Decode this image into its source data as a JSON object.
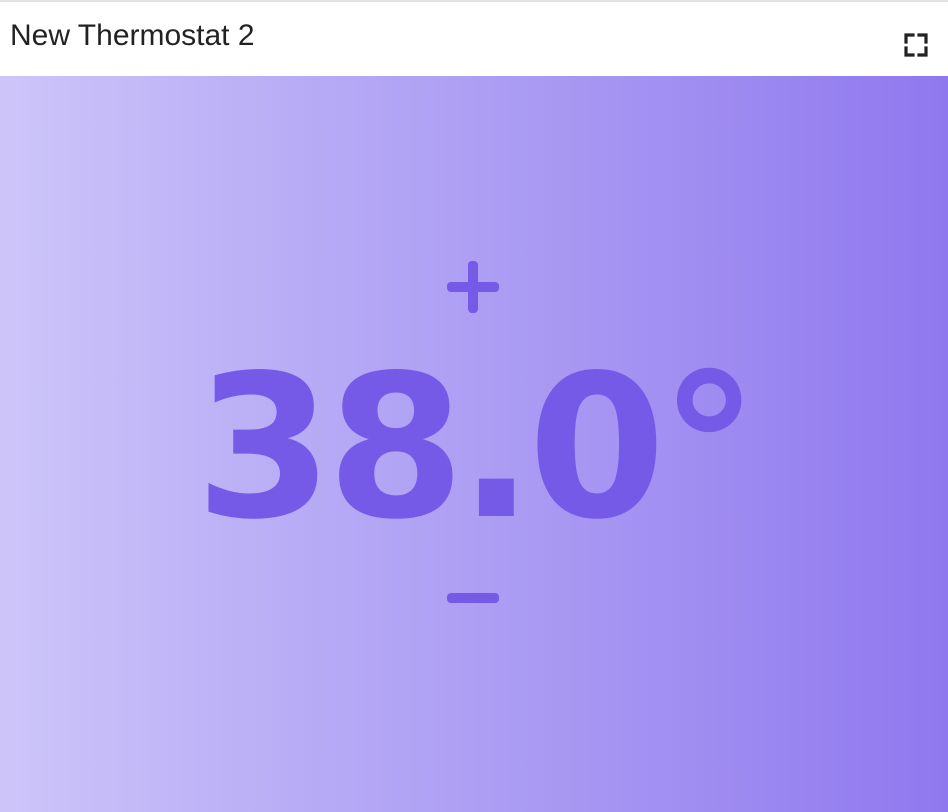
{
  "widget": {
    "title": "New Thermostat 2"
  },
  "thermostat": {
    "temperature": "38.0°",
    "increase_symbol": "+",
    "decrease_symbol": "–",
    "icons": {
      "expand": "fullscreen-expand-icon",
      "increase": "plus-icon",
      "decrease": "minus-icon"
    }
  },
  "colors": {
    "accent": "#755ae8",
    "gradient_start": "#cdc5fa",
    "gradient_end": "#8f78ef",
    "title_text": "#222222"
  }
}
